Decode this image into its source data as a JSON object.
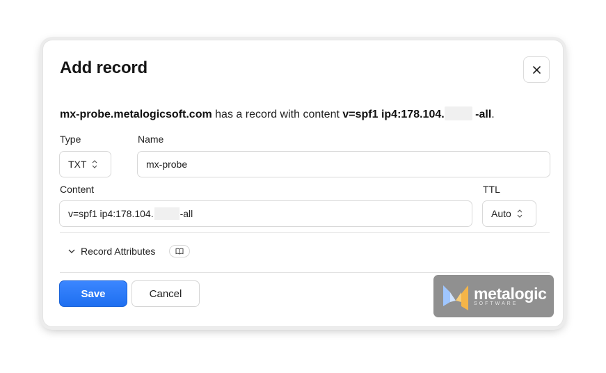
{
  "dialog": {
    "title": "Add record",
    "close_label": "×"
  },
  "summary": {
    "domain": "mx-probe.metalogicsoft.com",
    "middle": "has a record with content",
    "content_prefix": "v=spf1 ip4:178.104.",
    "content_suffix": "-all",
    "end": "."
  },
  "form": {
    "type_label": "Type",
    "type_value": "TXT",
    "name_label": "Name",
    "name_value": "mx-probe",
    "content_label": "Content",
    "content_prefix": "v=spf1 ip4:178.104.",
    "content_suffix": "-all",
    "ttl_label": "TTL",
    "ttl_value": "Auto"
  },
  "attributes": {
    "label": "Record Attributes"
  },
  "buttons": {
    "save": "Save",
    "cancel": "Cancel"
  },
  "watermark": {
    "name": "metalogic",
    "sub": "SOFTWARE"
  },
  "colors": {
    "primary": "#1e6ff0",
    "border": "#d9d9d9"
  }
}
